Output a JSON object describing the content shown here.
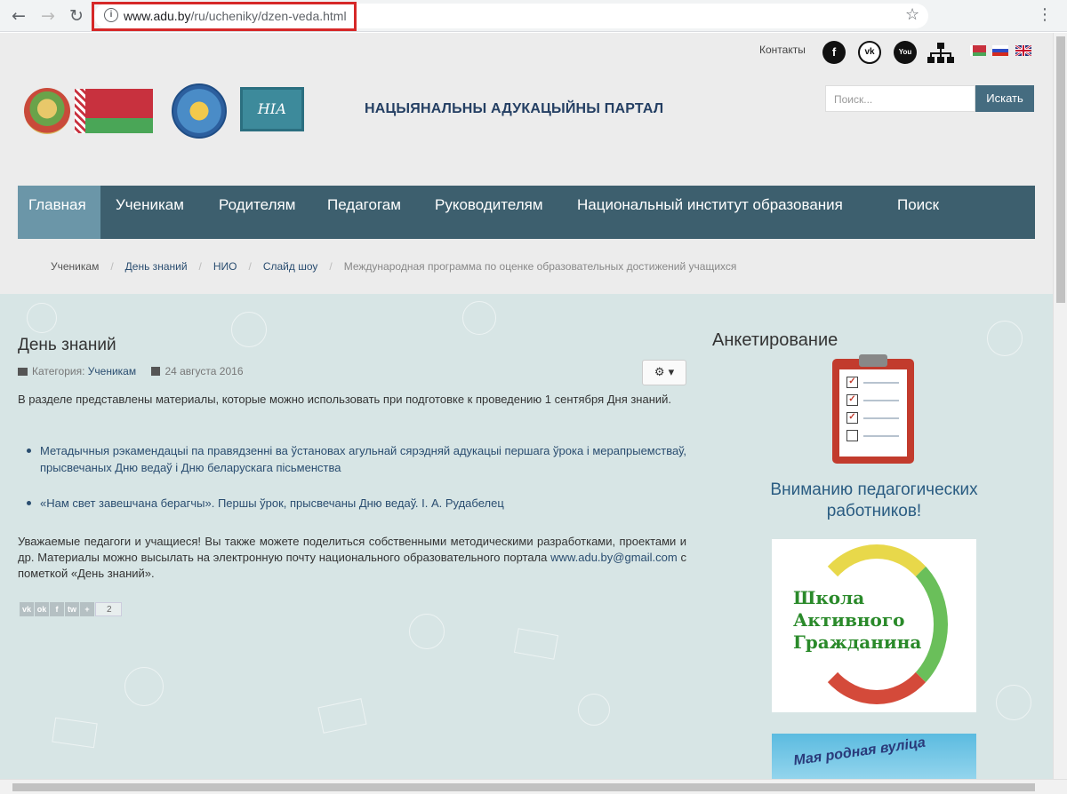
{
  "browser": {
    "url_host": "www.adu.by",
    "url_path": "/ru/ucheniky/dzen-veda.html",
    "back_icon": "back-arrow",
    "forward_icon": "forward-arrow",
    "reload_icon": "reload",
    "bookmark_icon": "star",
    "menu_icon": "kebab"
  },
  "header": {
    "contacts_label": "Контакты",
    "social": [
      "facebook",
      "vkontakte",
      "youtube",
      "sitemap"
    ],
    "facebook_glyph": "f",
    "vk_glyph": "vk",
    "youtube_glyph": "You",
    "languages": [
      "by",
      "ru",
      "en"
    ],
    "portal_title": "НАЦЫЯНАЛЬНЫ АДУКАЦЫЙНЫ ПАРТАЛ",
    "nia_logo_text": "НІА",
    "search_placeholder": "Поиск...",
    "search_button": "Искать"
  },
  "menu": {
    "items": [
      "Главная",
      "Ученикам",
      "Родителям",
      "Педагогам",
      "Руководителям",
      "Национальный институт образования",
      "Поиск"
    ],
    "active_index": 0
  },
  "breadcrumbs": {
    "items": [
      "Ученикам",
      "День знаний",
      "НИО",
      "Слайд шоу",
      "Международная программа по оценке образовательных достижений учащихся"
    ]
  },
  "article": {
    "title": "День знаний",
    "category_label": "Категория:",
    "category_value": "Ученикам",
    "date": "24 августа 2016",
    "gear_label": "⚙ ▾",
    "intro": "В разделе представлены материалы, которые можно использовать при подготовке к проведению 1 сентября Дня знаний.",
    "links": [
      "Метадычныя рэкамендацыі па правядзенні ва ўстановах агульнай сярэдняй адукацыі першага ўрока і мерапрыемстваў, прысвечаных Дню ведаў і Дню беларускага пісьменства",
      "«Нам свет завешчана берагчы». Першы ўрок, прысвечаны Дню ведаў. І. А. Рудабелец"
    ],
    "footer_text": "Уважаемые педагоги и учащиеся! Вы также можете поделиться собственными методическими разработками, проектами и др. Материалы можно высылать на электронную почту национального образовательного портала",
    "email": "www.adu.by@gmail.com",
    "footer_suffix": " с пометкой «День знаний».",
    "share_icons": [
      "vk",
      "ok",
      "f",
      "tw",
      "+"
    ],
    "share_count": "2"
  },
  "sidebar": {
    "title": "Анкетирование",
    "heading": "Вниманию педагогических работников!",
    "banner_text": "Школа Активного Гражданина",
    "banner2_text": "Мая родная вуліца"
  },
  "colors": {
    "menu_bg": "#3d5f6e",
    "menu_active": "#6b96a8",
    "content_bg": "#d7e5e5",
    "link": "#2a4d70",
    "url_highlight": "#d62828"
  }
}
